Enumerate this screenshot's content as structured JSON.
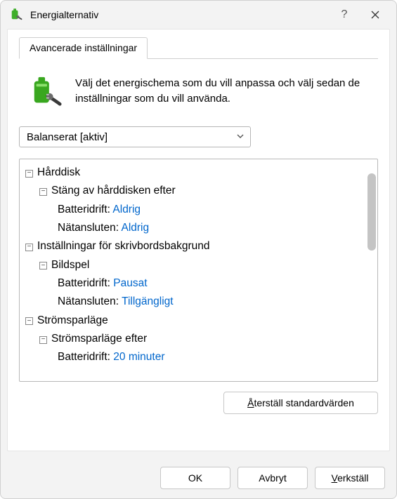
{
  "window": {
    "title": "Energialternativ"
  },
  "tab": {
    "label": "Avancerade inställningar"
  },
  "intro": {
    "text": "Välj det energischema som du vill anpassa och välj sedan de inställningar som du vill använda."
  },
  "plan": {
    "selected": "Balanserat [aktiv]"
  },
  "tree": {
    "harddisk": {
      "label": "Hårddisk",
      "turn_off": {
        "label": "Stäng av hårddisken efter",
        "battery_label": "Batteridrift:",
        "battery_value": "Aldrig",
        "plugged_label": "Nätansluten:",
        "plugged_value": "Aldrig"
      }
    },
    "desktop_bg": {
      "label": "Inställningar för skrivbordsbakgrund",
      "slideshow": {
        "label": "Bildspel",
        "battery_label": "Batteridrift:",
        "battery_value": "Pausat",
        "plugged_label": "Nätansluten:",
        "plugged_value": "Tillgängligt"
      }
    },
    "sleep": {
      "label": "Strömsparläge",
      "sleep_after": {
        "label": "Strömsparläge efter",
        "battery_label": "Batteridrift:",
        "battery_value": "20 minuter"
      }
    }
  },
  "buttons": {
    "restore_pre": "Å",
    "restore_post": "terställ standardvärden",
    "ok": "OK",
    "cancel": "Avbryt",
    "apply_pre": "V",
    "apply_post": "erkställ"
  }
}
